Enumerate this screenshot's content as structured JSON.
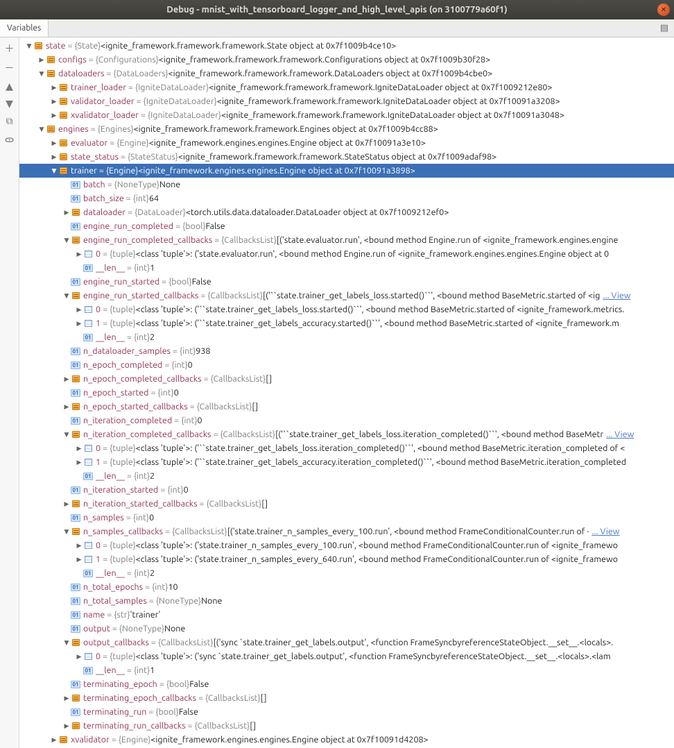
{
  "window": {
    "title": "Debug - mnist_with_tensorboard_logger_and_high_level_apis (on 3100779a60f1)"
  },
  "tabs": {
    "variables": "Variables"
  },
  "tree": [
    {
      "d": 0,
      "a": "down",
      "k": "obj",
      "n": "state",
      "t": "{State}",
      "v": "<ignite_framework.framework.framework.State object at 0x7f1009b4ce10>"
    },
    {
      "d": 1,
      "a": "right",
      "k": "obj",
      "n": "configs",
      "t": "{Configurations}",
      "v": "<ignite_framework.framework.framework.Configurations object at 0x7f1009b30f28>"
    },
    {
      "d": 1,
      "a": "down",
      "k": "obj",
      "n": "dataloaders",
      "t": "{DataLoaders}",
      "v": "<ignite_framework.framework.framework.DataLoaders object at 0x7f1009b4cbe0>"
    },
    {
      "d": 2,
      "a": "right",
      "k": "obj",
      "n": "trainer_loader",
      "t": "{IgniteDataLoader}",
      "v": "<ignite_framework.framework.framework.IgniteDataLoader object at 0x7f1009212e80>"
    },
    {
      "d": 2,
      "a": "right",
      "k": "obj",
      "n": "validator_loader",
      "t": "{IgniteDataLoader}",
      "v": "<ignite_framework.framework.framework.IgniteDataLoader object at 0x7f10091a3208>"
    },
    {
      "d": 2,
      "a": "right",
      "k": "obj",
      "n": "xvalidator_loader",
      "t": "{IgniteDataLoader}",
      "v": "<ignite_framework.framework.framework.IgniteDataLoader object at 0x7f10091a3048>"
    },
    {
      "d": 1,
      "a": "down",
      "k": "obj",
      "n": "engines",
      "t": "{Engines}",
      "v": "<ignite_framework.framework.framework.Engines object at 0x7f1009b4cc88>"
    },
    {
      "d": 2,
      "a": "right",
      "k": "obj",
      "n": "evaluator",
      "t": "{Engine}",
      "v": "<ignite_framework.engines.engines.Engine object at 0x7f10091a3e10>"
    },
    {
      "d": 2,
      "a": "right",
      "k": "obj",
      "n": "state_status",
      "t": "{StateStatus}",
      "v": "<ignite_framework.framework.framework.StateStatus object at 0x7f1009adaf98>"
    },
    {
      "d": 2,
      "a": "down",
      "k": "obj",
      "n": "trainer",
      "t": "{Engine}",
      "v": "<ignite_framework.engines.engines.Engine object at 0x7f10091a3898>",
      "sel": true
    },
    {
      "d": 3,
      "a": "",
      "k": "prim",
      "n": "batch",
      "t": "{NoneType}",
      "v": "None"
    },
    {
      "d": 3,
      "a": "",
      "k": "prim",
      "n": "batch_size",
      "t": "{int}",
      "v": "64"
    },
    {
      "d": 3,
      "a": "right",
      "k": "obj",
      "n": "dataloader",
      "t": "{DataLoader}",
      "v": "<torch.utils.data.dataloader.DataLoader object at 0x7f1009212ef0>"
    },
    {
      "d": 3,
      "a": "",
      "k": "prim",
      "n": "engine_run_completed",
      "t": "{bool}",
      "v": "False"
    },
    {
      "d": 3,
      "a": "down",
      "k": "obj",
      "n": "engine_run_completed_callbacks",
      "t": "{CallbacksList}",
      "v": "[('state.evaluator.run', <bound method Engine.run of <ignite_framework.engines.engine"
    },
    {
      "d": 4,
      "a": "right",
      "k": "list",
      "n": "0",
      "t": "{tuple}",
      "v": "<class 'tuple'>: ('state.evaluator.run', <bound method Engine.run of <ignite_framework.engines.engines.Engine object at 0"
    },
    {
      "d": 4,
      "a": "",
      "k": "prim",
      "n": "__len__",
      "t": "{int}",
      "v": "1"
    },
    {
      "d": 3,
      "a": "",
      "k": "prim",
      "n": "engine_run_started",
      "t": "{bool}",
      "v": "False"
    },
    {
      "d": 3,
      "a": "down",
      "k": "obj",
      "n": "engine_run_started_callbacks",
      "t": "{CallbacksList}",
      "v": "[('``state.trainer_get_labels_loss.started()``', <bound method BaseMetric.started of <ig",
      "view": true
    },
    {
      "d": 4,
      "a": "right",
      "k": "list",
      "n": "0",
      "t": "{tuple}",
      "v": "<class 'tuple'>: ('``state.trainer_get_labels_loss.started()``', <bound method BaseMetric.started of <ignite_framework.metrics."
    },
    {
      "d": 4,
      "a": "right",
      "k": "list",
      "n": "1",
      "t": "{tuple}",
      "v": "<class 'tuple'>: ('``state.trainer_get_labels_accuracy.started()``', <bound method BaseMetric.started of <ignite_framework.m"
    },
    {
      "d": 4,
      "a": "",
      "k": "prim",
      "n": "__len__",
      "t": "{int}",
      "v": "2"
    },
    {
      "d": 3,
      "a": "",
      "k": "prim",
      "n": "n_dataloader_samples",
      "t": "{int}",
      "v": "938"
    },
    {
      "d": 3,
      "a": "",
      "k": "prim",
      "n": "n_epoch_completed",
      "t": "{int}",
      "v": "0"
    },
    {
      "d": 3,
      "a": "right",
      "k": "obj",
      "n": "n_epoch_completed_callbacks",
      "t": "{CallbacksList}",
      "v": "[]"
    },
    {
      "d": 3,
      "a": "",
      "k": "prim",
      "n": "n_epoch_started",
      "t": "{int}",
      "v": "0"
    },
    {
      "d": 3,
      "a": "right",
      "k": "obj",
      "n": "n_epoch_started_callbacks",
      "t": "{CallbacksList}",
      "v": "[]"
    },
    {
      "d": 3,
      "a": "",
      "k": "prim",
      "n": "n_iteration_completed",
      "t": "{int}",
      "v": "0"
    },
    {
      "d": 3,
      "a": "down",
      "k": "obj",
      "n": "n_iteration_completed_callbacks",
      "t": "{CallbacksList}",
      "v": "[('``state.trainer_get_labels_loss.iteration_completed()``', <bound method BaseMetr",
      "view": true
    },
    {
      "d": 4,
      "a": "right",
      "k": "list",
      "n": "0",
      "t": "{tuple}",
      "v": "<class 'tuple'>: ('``state.trainer_get_labels_loss.iteration_completed()``', <bound method BaseMetric.iteration_completed of <"
    },
    {
      "d": 4,
      "a": "right",
      "k": "list",
      "n": "1",
      "t": "{tuple}",
      "v": "<class 'tuple'>: ('``state.trainer_get_labels_accuracy.iteration_completed()``', <bound method BaseMetric.iteration_completed"
    },
    {
      "d": 4,
      "a": "",
      "k": "prim",
      "n": "__len__",
      "t": "{int}",
      "v": "2"
    },
    {
      "d": 3,
      "a": "",
      "k": "prim",
      "n": "n_iteration_started",
      "t": "{int}",
      "v": "0"
    },
    {
      "d": 3,
      "a": "right",
      "k": "obj",
      "n": "n_iteration_started_callbacks",
      "t": "{CallbacksList}",
      "v": "[]"
    },
    {
      "d": 3,
      "a": "",
      "k": "prim",
      "n": "n_samples",
      "t": "{int}",
      "v": "0"
    },
    {
      "d": 3,
      "a": "down",
      "k": "obj",
      "n": "n_samples_callbacks",
      "t": "{CallbacksList}",
      "v": "[('state.trainer_n_samples_every_100.run', <bound method FrameConditionalCounter.run of ·",
      "view": true
    },
    {
      "d": 4,
      "a": "right",
      "k": "list",
      "n": "0",
      "t": "{tuple}",
      "v": "<class 'tuple'>: ('state.trainer_n_samples_every_100.run', <bound method FrameConditionalCounter.run of <ignite_framewo"
    },
    {
      "d": 4,
      "a": "right",
      "k": "list",
      "n": "1",
      "t": "{tuple}",
      "v": "<class 'tuple'>: ('state.trainer_n_samples_every_640.run', <bound method FrameConditionalCounter.run of <ignite_framewo"
    },
    {
      "d": 4,
      "a": "",
      "k": "prim",
      "n": "__len__",
      "t": "{int}",
      "v": "2"
    },
    {
      "d": 3,
      "a": "",
      "k": "prim",
      "n": "n_total_epochs",
      "t": "{int}",
      "v": "10"
    },
    {
      "d": 3,
      "a": "",
      "k": "prim",
      "n": "n_total_samples",
      "t": "{NoneType}",
      "v": "None"
    },
    {
      "d": 3,
      "a": "",
      "k": "prim",
      "n": "name",
      "t": "{str}",
      "v": "'trainer'"
    },
    {
      "d": 3,
      "a": "",
      "k": "prim",
      "n": "output",
      "t": "{NoneType}",
      "v": "None"
    },
    {
      "d": 3,
      "a": "down",
      "k": "obj",
      "n": "output_callbacks",
      "t": "{CallbacksList}",
      "v": "[('sync `state.trainer_get_labels.output', <function FrameSyncbyreferenceStateObject.__set__.<locals>."
    },
    {
      "d": 4,
      "a": "right",
      "k": "list",
      "n": "0",
      "t": "{tuple}",
      "v": "<class 'tuple'>: ('sync `state.trainer_get_labels.output', <function FrameSyncbyreferenceStateObject.__set__.<locals>.<lam"
    },
    {
      "d": 4,
      "a": "",
      "k": "prim",
      "n": "__len__",
      "t": "{int}",
      "v": "1"
    },
    {
      "d": 3,
      "a": "",
      "k": "prim",
      "n": "terminating_epoch",
      "t": "{bool}",
      "v": "False"
    },
    {
      "d": 3,
      "a": "right",
      "k": "obj",
      "n": "terminating_epoch_callbacks",
      "t": "{CallbacksList}",
      "v": "[]"
    },
    {
      "d": 3,
      "a": "",
      "k": "prim",
      "n": "terminating_run",
      "t": "{bool}",
      "v": "False"
    },
    {
      "d": 3,
      "a": "right",
      "k": "obj",
      "n": "terminating_run_callbacks",
      "t": "{CallbacksList}",
      "v": "[]"
    },
    {
      "d": 2,
      "a": "right",
      "k": "obj",
      "n": "xvalidator",
      "t": "{Engine}",
      "v": "<ignite_framework.engines.engines.Engine object at 0x7f10091d4208>"
    }
  ],
  "viewText": "... View"
}
